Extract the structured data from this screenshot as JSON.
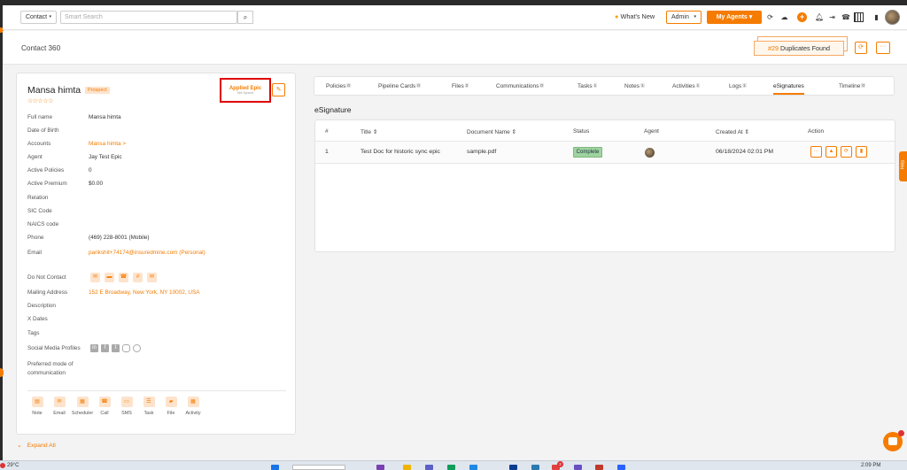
{
  "header": {
    "entity_select": "Contact",
    "search_placeholder": "Smart Search",
    "whats_new": "What's New",
    "role_select": "Admin",
    "my_agents": "My Agents"
  },
  "subheader": {
    "title": "Contact 360",
    "duplicates_count": "#29",
    "duplicates_label": "Duplicates Found"
  },
  "contact": {
    "name": "Mansa himta",
    "status_badge": "Prospect",
    "stars": "☆☆☆☆☆",
    "integration_label": "Applied Epic",
    "integration_sub": "Not Synced",
    "fields": [
      {
        "label": "Full name",
        "value": "Mansa himta",
        "link": false
      },
      {
        "label": "Date of Birth",
        "value": "",
        "link": false
      },
      {
        "label": "Accounts",
        "value": "Mansa himta >",
        "link": true
      },
      {
        "label": "Agent",
        "value": "Jay Test Epic",
        "link": false
      },
      {
        "label": "Active Policies",
        "value": "0",
        "link": false
      },
      {
        "label": "Active Premium",
        "value": "$0.00",
        "link": false
      },
      {
        "label": "Relation",
        "value": "",
        "link": false
      },
      {
        "label": "SIC Code",
        "value": "",
        "link": false
      },
      {
        "label": "NAICS code",
        "value": "",
        "link": false
      },
      {
        "label": "Phone",
        "value": "(469) 228-8001 (Mobile)",
        "link": false
      },
      {
        "label": "Email",
        "value": "parikshit+74174@insuredmine.com (Personal)",
        "link": true
      }
    ],
    "fields2": [
      {
        "label": "Do Not Contact",
        "value": "",
        "link": false
      },
      {
        "label": "Mailing Address",
        "value": "152 E Broadway, New York, NY 10002, USA",
        "link": true
      },
      {
        "label": "Description",
        "value": "",
        "link": false
      },
      {
        "label": "X Dates",
        "value": "",
        "link": false
      },
      {
        "label": "Tags",
        "value": "",
        "link": false
      },
      {
        "label": "Social Media Profiles",
        "value": "",
        "link": false
      }
    ],
    "preferred_mode_label": "Preferred mode of communication",
    "actions": [
      "Note",
      "Email",
      "Scheduler",
      "Call",
      "SMS",
      "Task",
      "File",
      "Activity"
    ],
    "expand_all": "Expand All"
  },
  "tabs": [
    {
      "label": "Policies",
      "count": "0"
    },
    {
      "label": "Pipeline Cards",
      "count": "0"
    },
    {
      "label": "Files",
      "count": "2"
    },
    {
      "label": "Communications",
      "count": "0"
    },
    {
      "label": "Tasks",
      "count": "1"
    },
    {
      "label": "Notes",
      "count": "1"
    },
    {
      "label": "Activities",
      "count": "1"
    },
    {
      "label": "Logs",
      "count": "1"
    },
    {
      "label": "eSignatures",
      "count": ""
    },
    {
      "label": "Timeline",
      "count": "0"
    }
  ],
  "esign": {
    "section_title": "eSignature",
    "columns": [
      "#",
      "Title ⇕",
      "Document Name ⇕",
      "Status",
      "Agent",
      "Created At ⇕",
      "Action"
    ],
    "rows": [
      {
        "num": "1",
        "title": "Test Doc for historic sync epic",
        "document": "sample.pdf",
        "status": "Complete",
        "created": "06/18/2024 02:01 PM"
      }
    ]
  },
  "side_tab": "Help",
  "taskbar": {
    "temp": "29°C",
    "time": "2:09 PM",
    "notif_count": "2"
  },
  "colors": {
    "accent": "#f57c00",
    "complete_bg": "#9fd39f"
  }
}
